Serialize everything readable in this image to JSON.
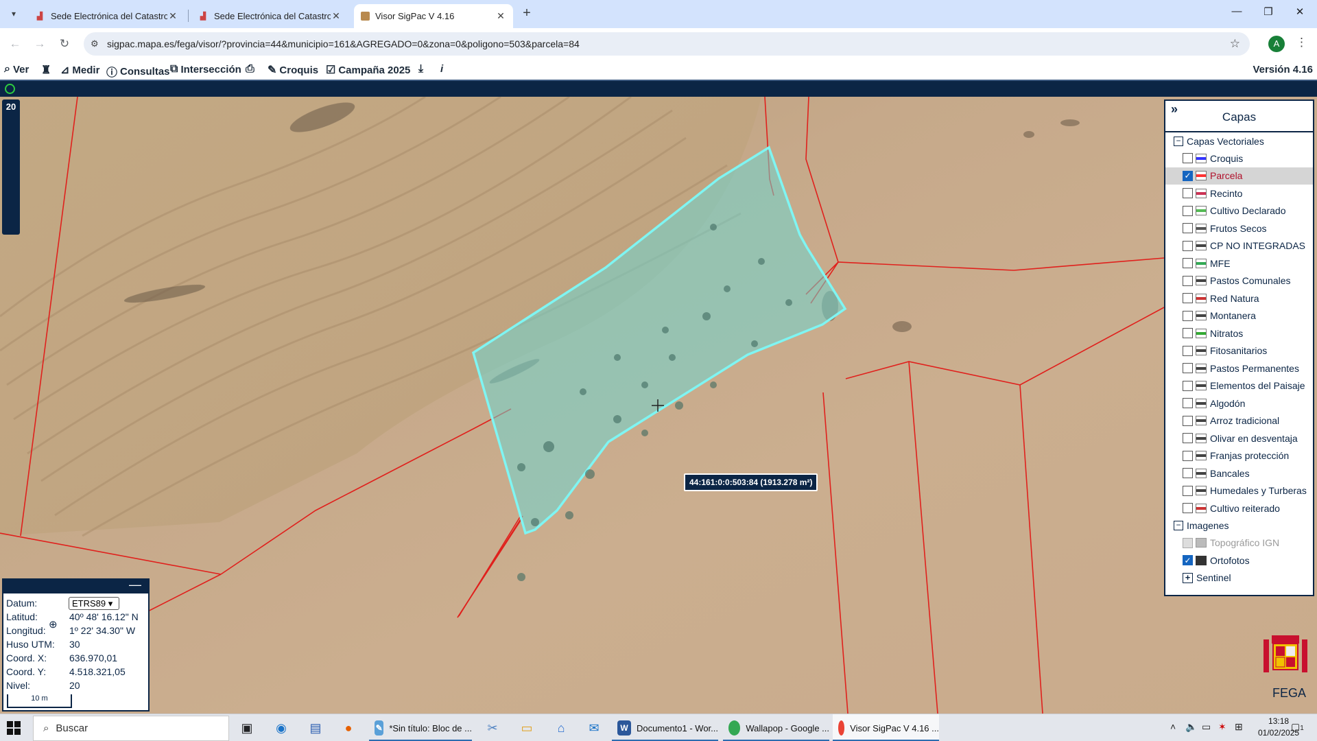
{
  "browser": {
    "tabs": [
      {
        "title": "Sede Electrónica del Catastro -",
        "active": false
      },
      {
        "title": "Sede Electrónica del Catastro",
        "active": false
      },
      {
        "title": "Visor SigPac V 4.16",
        "active": true
      }
    ],
    "url": "sigpac.mapa.es/fega/visor/?provincia=44&municipio=161&AGREGADO=0&zona=0&poligono=503&parcela=84",
    "profile_initial": "A"
  },
  "menubar": {
    "items": [
      "Ver",
      "",
      "Medir",
      "Consultas",
      "Intersección",
      "",
      "Croquis",
      "Campaña 2025",
      "",
      "i"
    ],
    "ver": "Ver",
    "medir": "Medir",
    "consultas": "Consultas",
    "interseccion": "Intersección",
    "croquis": "Croquis",
    "campana": "Campaña 2025",
    "version": "Versión 4.16"
  },
  "map": {
    "zoom_level": "20",
    "parcel_label": "44:161:0:0:503:84 (1913.278 m²)"
  },
  "layers_panel": {
    "title": "Capas",
    "vector_group": "Capas Vectoriales",
    "vector_layers": [
      {
        "label": "Croquis",
        "checked": false,
        "color": "#3333ff"
      },
      {
        "label": "Parcela",
        "checked": true,
        "color": "#ff3333"
      },
      {
        "label": "Recinto",
        "checked": false,
        "color": "#cc3355"
      },
      {
        "label": "Cultivo Declarado",
        "checked": false,
        "color": "#55bb55"
      },
      {
        "label": "Frutos Secos",
        "checked": false,
        "color": "#555555"
      },
      {
        "label": "CP NO INTEGRADAS",
        "checked": false,
        "color": "#444444"
      },
      {
        "label": "MFE",
        "checked": false,
        "color": "#33aa55"
      },
      {
        "label": "Pastos Comunales",
        "checked": false,
        "color": "#444444"
      },
      {
        "label": "Red Natura",
        "checked": false,
        "color": "#cc3333"
      },
      {
        "label": "Montanera",
        "checked": false,
        "color": "#444444"
      },
      {
        "label": "Nitratos",
        "checked": false,
        "color": "#33aa33"
      },
      {
        "label": "Fitosanitarios",
        "checked": false,
        "color": "#444444"
      },
      {
        "label": "Pastos Permanentes",
        "checked": false,
        "color": "#444444"
      },
      {
        "label": "Elementos del Paisaje",
        "checked": false,
        "color": "#444444"
      },
      {
        "label": "Algodón",
        "checked": false,
        "color": "#444444"
      },
      {
        "label": "Arroz tradicional",
        "checked": false,
        "color": "#444444"
      },
      {
        "label": "Olivar en desventaja",
        "checked": false,
        "color": "#444444"
      },
      {
        "label": "Franjas protección",
        "checked": false,
        "color": "#444444"
      },
      {
        "label": "Bancales",
        "checked": false,
        "color": "#444444"
      },
      {
        "label": "Humedales y Turberas",
        "checked": false,
        "color": "#444444"
      },
      {
        "label": "Cultivo reiterado",
        "checked": false,
        "color": "#cc3333"
      }
    ],
    "image_group": "Imagenes",
    "image_layers": [
      {
        "label": "Topográfico IGN",
        "checked": false,
        "disabled": true
      },
      {
        "label": "Ortofotos",
        "checked": true,
        "disabled": false
      }
    ],
    "sentinel": "Sentinel"
  },
  "coords": {
    "datum_label": "Datum:",
    "datum_value": "ETRS89",
    "lat_label": "Latitud:",
    "lat_value": "40º 48' 16.12\" N",
    "lon_label": "Longitud:",
    "lon_value": "1º 22' 34.30\" W",
    "huso_label": "Huso UTM:",
    "huso_value": "30",
    "x_label": "Coord. X:",
    "x_value": "636.970,01",
    "y_label": "Coord. Y:",
    "y_value": "4.518.321,05",
    "nivel_label": "Nivel:",
    "nivel_value": "20",
    "scale": "10 m"
  },
  "fega": "FEGA",
  "taskbar": {
    "search_placeholder": "Buscar",
    "apps": [
      {
        "label": "*Sin título: Bloc de ..."
      },
      {
        "label": "Documento1 - Wor..."
      },
      {
        "label": "Wallapop - Google ..."
      },
      {
        "label": "Visor SigPac V 4.16 ..."
      }
    ],
    "time": "13:18",
    "date": "01/02/2025",
    "notifications": "1"
  }
}
